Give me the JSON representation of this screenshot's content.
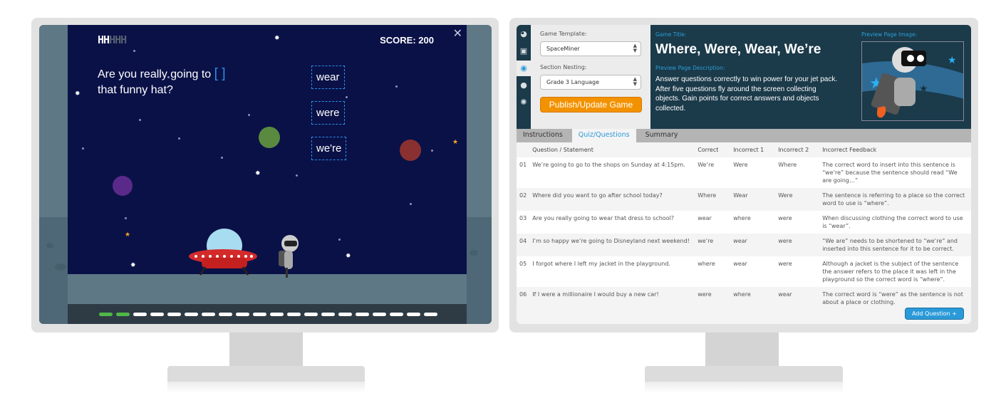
{
  "game": {
    "lives_full": "HH",
    "lives_empty": "HHH",
    "score": "SCORE: 200",
    "close_icon": "close-icon",
    "question_before": "Are you really going to",
    "blank": "[ ]",
    "question_after": "that funny hat?",
    "answers": [
      "wear",
      "were",
      "we're"
    ],
    "progress": {
      "completed": 2,
      "total": 20
    },
    "colors": {
      "space": "#0a1147",
      "ground": "#5e7886",
      "answer_border": "#2a8ee8",
      "progress_done": "#4fb848"
    }
  },
  "editor": {
    "sidebar": [
      "dashboard-icon",
      "images-icon",
      "gamepad-icon",
      "user-icon",
      "settings-icon"
    ],
    "active_sidebar": 2,
    "template_label": "Game Template:",
    "template_value": "SpaceMiner",
    "nesting_label": "Section Nesting:",
    "nesting_value": "Grade 3 Language",
    "publish": "Publish/Update Game",
    "title_label": "Game Title:",
    "title": "Where, Were, Wear, We’re",
    "desc_label": "Preview Page Description:",
    "description": "Answer questions correctly to win power for your jet pack. After five questions fly around the screen collecting objects. Gain points for correct answers and objects collected.",
    "image_label": "Preview Page Image:",
    "tabs": [
      "Instructions",
      "Quiz/Questions",
      "Summary"
    ],
    "active_tab": 1,
    "columns": [
      "Question / Statement",
      "Correct",
      "Incorrect 1",
      "Incorrect 2",
      "Incorrect Feedback"
    ],
    "rows": [
      [
        "01",
        "We’re going to go to the shops on Sunday at 4:15pm.",
        "We’re",
        "Were",
        "Where",
        "The correct word to insert into this sentence is “we’re” because the sentence should read “We are going…”"
      ],
      [
        "02",
        "Where did you want to go after school today?",
        "Where",
        "Wear",
        "Were",
        "The sentence is referring to a place so the correct word to use is “where”."
      ],
      [
        "03",
        "Are you really going to wear that dress to school?",
        "wear",
        "where",
        "were",
        "When discussing clothing the correct word to use is “wear”."
      ],
      [
        "04",
        "I’m so happy we’re going to Disneyland next weekend!",
        "we’re",
        "wear",
        "were",
        "“We are” needs to be shortened to “we’re” and inserted into this sentence for it to be correct."
      ],
      [
        "05",
        "I forgot where I left my jacket in the playground.",
        "where",
        "wear",
        "were",
        "Although a jacket is the subject of the sentence the answer refers to the place it was left in the playground so the correct word is “where”."
      ],
      [
        "06",
        "If I were a millionaire I would buy a new car!",
        "were",
        "where",
        "wear",
        "The correct word is “were” as the sentence is not about a place or clothing."
      ]
    ],
    "add_question": "Add Question +",
    "colors": {
      "header": "#1b3a4a",
      "accent": "#2a9ad8",
      "publish": "#f39200"
    }
  }
}
